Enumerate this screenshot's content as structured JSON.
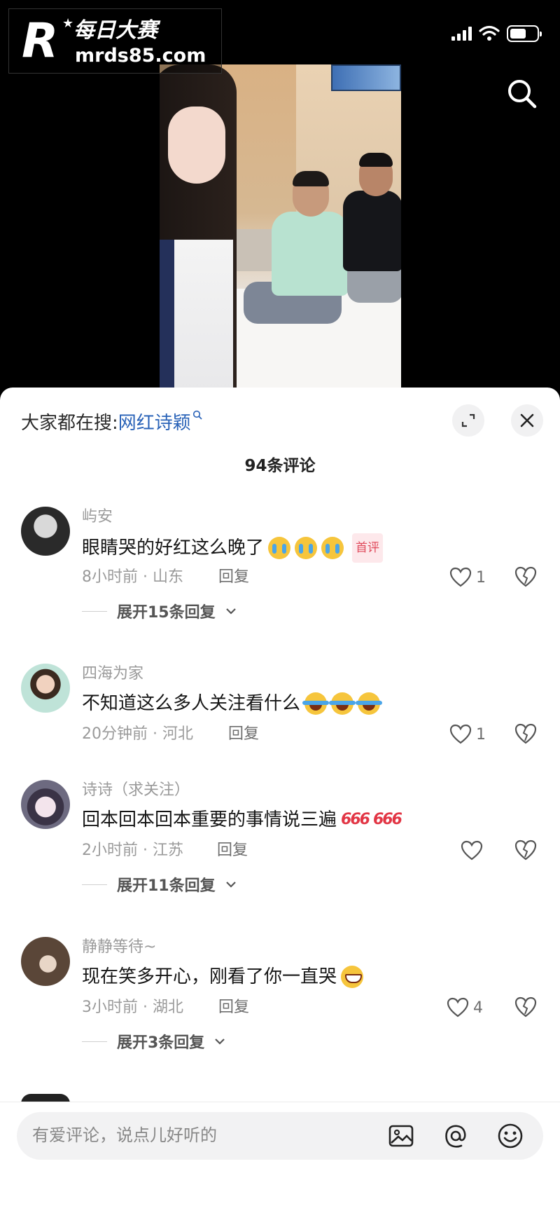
{
  "watermark": {
    "logo_letter": "R",
    "title": "每日大赛",
    "url": "mrds85.com"
  },
  "header": {
    "search_hint_prefix": "大家都在搜:",
    "search_hint_keyword": "网红诗颖",
    "comment_count": "94条评论"
  },
  "comments": [
    {
      "user": "屿安",
      "text": "眼睛哭的好红这么晚了",
      "emojis": [
        "loudly-crying-face",
        "loudly-crying-face",
        "loudly-crying-face"
      ],
      "badge": "首评",
      "time_location": "8小时前 · 山东",
      "reply_label": "回复",
      "likes": "1",
      "expand_label": "展开15条回复"
    },
    {
      "user": "四海为家",
      "text": "不知道这么多人关注看什么",
      "emojis": [
        "rolling-laughing-face",
        "rolling-laughing-face",
        "rolling-laughing-face"
      ],
      "time_location": "20分钟前 · 河北",
      "reply_label": "回复",
      "likes": "1"
    },
    {
      "user": "诗诗（求关注）",
      "text": "回本回本回本重要的事情说三遍",
      "emojis": [
        "666",
        "666"
      ],
      "time_location": "2小时前 · 江苏",
      "reply_label": "回复",
      "likes": "",
      "expand_label": "展开11条回复"
    },
    {
      "user": "静静等待~",
      "text": "现在笑多开心，刚看了你一直哭",
      "emojis": [
        "grinning-face"
      ],
      "time_location": "3小时前 · 湖北",
      "reply_label": "回复",
      "likes": "4",
      "expand_label": "展开3条回复"
    }
  ],
  "emoji_text": {
    "six": "666"
  },
  "input": {
    "placeholder": "有爱评论，说点儿好听的"
  },
  "colors": {
    "keyword": "#2a63b8",
    "badge_text": "#e04a5b",
    "badge_bg": "#fde8eb",
    "sheet_bg": "#ffffff"
  }
}
